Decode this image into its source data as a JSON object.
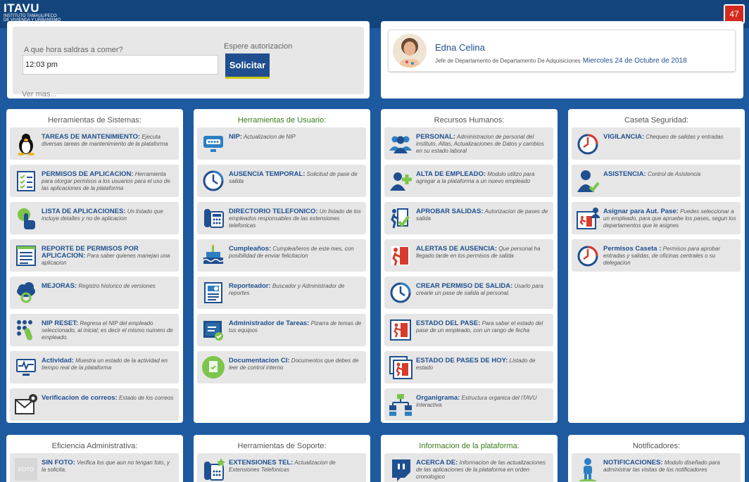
{
  "header": {
    "logo_main": "ITAVU",
    "logo_sub1": "INSTITUTO TAMAULIPECO",
    "logo_sub2": "DE VIVIENDA Y URBANISMO",
    "notifications_count": "47"
  },
  "meal": {
    "question": "A que hora saldras a comer?",
    "time_value": "12:03 pm",
    "wait_label": "Espere autorizacion",
    "button_label": "Solicitar",
    "more_link": "Ver mas..."
  },
  "user": {
    "name": "Edna Celina",
    "role": "Jefe de Departamento de Departamento De Adquisiciones",
    "date": "Miercoles 24 de Octubre de 2018"
  },
  "cards": [
    {
      "title": "Herramientas de Sistemas:",
      "title_color": "#555555",
      "items": [
        {
          "icon": "linux-icon",
          "title": "TAREAS DE MANTENIMIENTO:",
          "desc": "Ejecuta diversas tareas de mantenimiento de la plataforma"
        },
        {
          "icon": "checklist-icon",
          "title": "PERMISOS DE APLICACION:",
          "desc": "Herramienta para otorgar permisos a los usuarios para el uso de las aplicaciones de la plataforma"
        },
        {
          "icon": "touch-icon",
          "title": "LISTA DE APLICACIONES:",
          "desc": "Un listado que incluye detalles y no de aplicacion"
        },
        {
          "icon": "report-icon",
          "title": "REPORTE DE PERMISOS POR APLICACION:",
          "desc": "Para saber quienes manejan una aplicacion"
        },
        {
          "icon": "cloud-icon",
          "title": "MEJORAS:",
          "desc": "Registro historico de versiones"
        },
        {
          "icon": "keypad-icon",
          "title": "NIP RESET:",
          "desc": "Regresa el NIP del empleado seleccionado, al inicial; es decir el mismo numero de empleado."
        },
        {
          "icon": "monitor-pulse-icon",
          "title": "Actividad:",
          "desc": "Muestra un estado de la actividad en tiempo real de la plataforma"
        },
        {
          "icon": "mail-gear-icon",
          "title": "Verificacion de correos:",
          "desc": "Estado de los correos"
        }
      ]
    },
    {
      "title": "Herramientas de Usuario:",
      "title_color": "#3a7b1a",
      "items": [
        {
          "icon": "nip-icon",
          "title": "NIP:",
          "desc": "Actualizacion de NIP"
        },
        {
          "icon": "clock-icon",
          "title": "AUSENCIA TEMPORAL:",
          "desc": "Solicitud de pase de salida"
        },
        {
          "icon": "phone-icon",
          "title": "DIRECTORIO TELEFONICO:",
          "desc": "Un listado de los empleados responsables de las extensiones telefonicas"
        },
        {
          "icon": "cake-icon",
          "title": "Cumpleaños:",
          "desc": "Cumpleañeros de este mes, con posibilidad de enviar felicitacion"
        },
        {
          "icon": "document-chart-icon",
          "title": "Reporteador:",
          "desc": "Buscador y Administrador de reportes"
        },
        {
          "icon": "task-board-icon",
          "title": "Administrador de Tareas:",
          "desc": "Pizarra de temas de tus equipos"
        },
        {
          "icon": "doc-check-icon",
          "title": "Documentacion CI:",
          "desc": "Documentos que debes de leer de control interno"
        }
      ]
    },
    {
      "title": "Recursos Humanos:",
      "title_color": "#555555",
      "items": [
        {
          "icon": "users-icon",
          "title": "PERSONAL:",
          "desc": "Administracion de personal del instituto, Altas, Actualizaciones de Datos y cambios en su estado laboral"
        },
        {
          "icon": "user-add-icon",
          "title": "ALTA DE EMPLEADO:",
          "desc": "Modulo utilizo para agregar a la plataforma a un nuevo empleado"
        },
        {
          "icon": "exit-check-icon",
          "title": "APROBAR SALIDAS:",
          "desc": "Autorizacion de pases de salida"
        },
        {
          "icon": "exit-alert-icon",
          "title": "ALERTAS DE AUSENCIA:",
          "desc": "Que personal ha llegado tarde en los permisos de salida"
        },
        {
          "icon": "clock-icon",
          "title": "CREAR PERMISO DE SALIDA:",
          "desc": "Usarlo para crearle un pase de salida al personal."
        },
        {
          "icon": "exit-icon",
          "title": "ESTADO DEL PASE:",
          "desc": "Para saber el estado del pase de un empleado, con un rango de fecha"
        },
        {
          "icon": "exit-list-icon",
          "title": "ESTADO DE PASES DE HOY:",
          "desc": "Listado de estado"
        },
        {
          "icon": "org-chart-icon",
          "title": "Organigrama:",
          "desc": "Estructura organica del ITAVU interactiva"
        }
      ]
    },
    {
      "title": "Caseta Seguridad:",
      "title_color": "#555555",
      "items": [
        {
          "icon": "alarm-clock-icon",
          "title": "VIGILANCIA:",
          "desc": "Chequeo de salidas y entradas"
        },
        {
          "icon": "user-check-icon",
          "title": "ASISTENCIA:",
          "desc": "Control de Asistencia"
        },
        {
          "icon": "pass-user-icon",
          "title": "Asignar para Aut. Pase:",
          "desc": "Puedes seleccionar a un empleado, para que apruebe los pases, segun los departamentos que le asignes"
        },
        {
          "icon": "alarm-clock-icon",
          "title": "Permisos Caseta :",
          "desc": "Permisos para aprobar entradas y salidas, de oficinas centrales o su delegacion"
        }
      ]
    },
    {
      "title": "Eficiencia Administrativa:",
      "title_color": "#555555",
      "items": [
        {
          "icon": "no-photo-icon",
          "photo_label": "FOTO",
          "title": "SIN FOTO:",
          "desc": "Verifica los que aun no tengan foto, y la solicita."
        }
      ]
    },
    {
      "title": "Herramientas de Soporte:",
      "title_color": "#555555",
      "items": [
        {
          "icon": "phone-star-icon",
          "title": "EXTENSIONES TEL:",
          "desc": "Actualizacion de Extensiones Telefonicas"
        }
      ]
    },
    {
      "title": "Informacion de la plataforma:",
      "title_color": "#3a7b1a",
      "items": [
        {
          "icon": "twitch-icon",
          "title": "ACERCA DE:",
          "desc": "Informacion de las actualizaciones de las aplicaciones de la plataforma en orden cronologico"
        }
      ]
    },
    {
      "title": "Notificadores:",
      "title_color": "#555555",
      "items": [
        {
          "icon": "person-bell-icon",
          "title": "NOTIFICACIONES:",
          "desc": "Modulo diseñado para administrar las visitas de los notificadores"
        }
      ]
    }
  ]
}
